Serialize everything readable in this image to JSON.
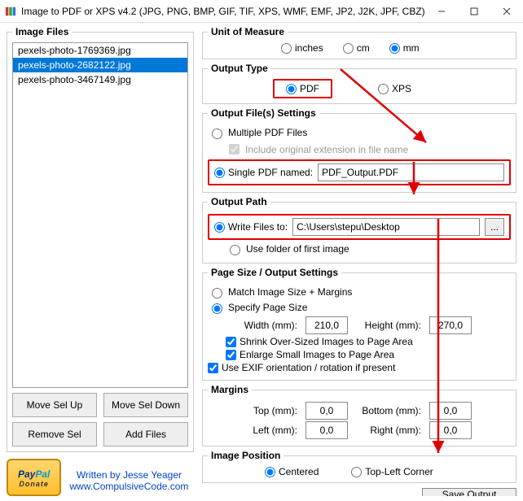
{
  "window": {
    "title": "Image to PDF or XPS  v4.2   (JPG, PNG, BMP, GIF, TIF, XPS, WMF, EMF, JP2, J2K, JPF, CBZ)"
  },
  "files": {
    "legend": "Image Files",
    "items": [
      {
        "name": "pexels-photo-1769369.jpg",
        "selected": false
      },
      {
        "name": "pexels-photo-2682122.jpg",
        "selected": true
      },
      {
        "name": "pexels-photo-3467149.jpg",
        "selected": false
      }
    ],
    "move_up": "Move Sel Up",
    "move_down": "Move Sel Down",
    "remove": "Remove Sel",
    "add": "Add Files"
  },
  "credits": {
    "written_by": "Written by Jesse Yeager",
    "site": "www.CompulsiveCode.com",
    "paypal_pay": "Pay",
    "paypal_pal": "Pal",
    "donate": "Donate"
  },
  "unit": {
    "legend": "Unit of Measure",
    "opts": {
      "inches": "inches",
      "cm": "cm",
      "mm": "mm"
    },
    "selected": "mm"
  },
  "output_type": {
    "legend": "Output Type",
    "opts": {
      "pdf": "PDF",
      "xps": "XPS"
    },
    "selected": "pdf"
  },
  "output_files": {
    "legend": "Output File(s) Settings",
    "multiple": "Multiple PDF Files",
    "include_ext": "Include original extension in file name",
    "single": "Single PDF named:",
    "single_value": "PDF_Output.PDF",
    "selected": "single"
  },
  "output_path": {
    "legend": "Output Path",
    "write_to": "Write Files to:",
    "path_value": "C:\\Users\\stepu\\Desktop",
    "use_folder": "Use folder of first image",
    "browse": "...",
    "selected": "write"
  },
  "page_size": {
    "legend": "Page Size / Output Settings",
    "match": "Match Image Size + Margins",
    "specify": "Specify Page Size",
    "width_label": "Width (mm):",
    "width_value": "210,0",
    "height_label": "Height (mm):",
    "height_value": "270,0",
    "shrink": "Shrink Over-Sized Images to Page Area",
    "enlarge": "Enlarge Small Images to Page Area",
    "exif": "Use EXIF orientation / rotation if present",
    "selected": "specify"
  },
  "margins": {
    "legend": "Margins",
    "top_label": "Top (mm):",
    "top_value": "0,0",
    "bottom_label": "Bottom (mm):",
    "bottom_value": "0,0",
    "left_label": "Left (mm):",
    "left_value": "0,0",
    "right_label": "Right (mm):",
    "right_value": "0,0"
  },
  "position": {
    "legend": "Image Position",
    "centered": "Centered",
    "topleft": "Top-Left Corner",
    "selected": "centered"
  },
  "save": "Save Output"
}
